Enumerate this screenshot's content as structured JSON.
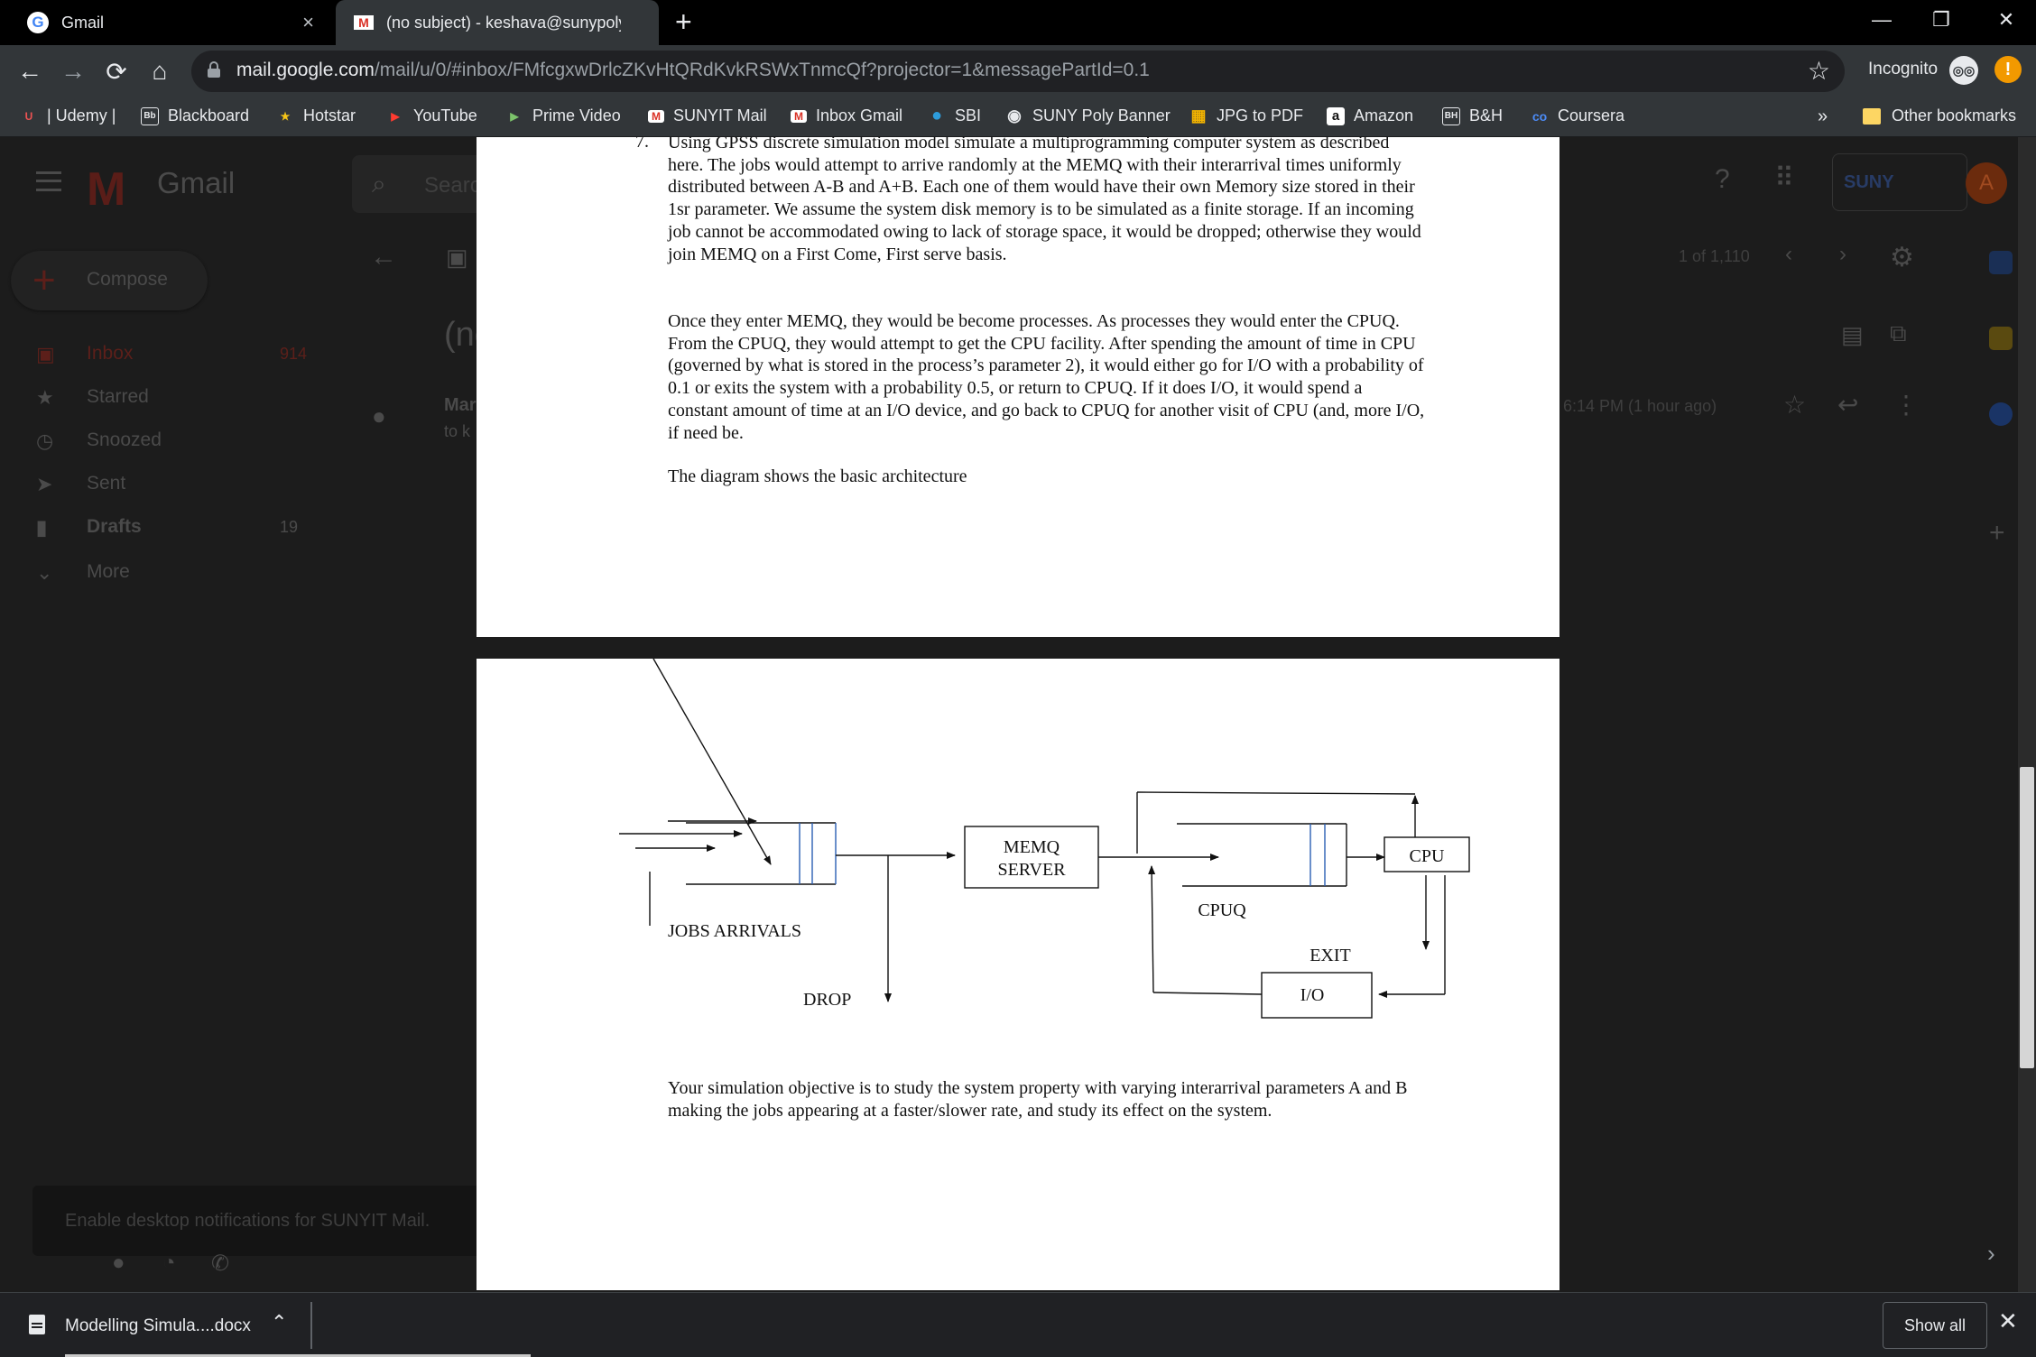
{
  "browser": {
    "tabs": [
      {
        "title": "Gmail",
        "close": "×"
      },
      {
        "title": "(no subject) - keshava@sunypoly",
        "close": "×"
      }
    ],
    "new_tab": "+",
    "window_controls": {
      "minimize": "—",
      "restore": "❐",
      "close": "✕"
    },
    "nav": {
      "back": "←",
      "forward": "→",
      "reload": "⟳",
      "home": "⌂"
    },
    "url_host": "mail.google.com",
    "url_path": "/mail/u/0/#inbox/FMfcgxwDrlcZKvHtQRdKvkRSWxTnmcQf?projector=1&messagePartId=0.1",
    "bookmark_star": "☆",
    "incognito_label": "Incognito",
    "incognito_icon_glyph": "◎◎",
    "alert_glyph": "!",
    "bookmarks": [
      {
        "label": "| Udemy |",
        "icon": "U",
        "color": "#ec5252"
      },
      {
        "label": "Blackboard",
        "icon": "Bb",
        "color": "#ffffff"
      },
      {
        "label": "Hotstar",
        "icon": "★",
        "color": "#f5c518"
      },
      {
        "label": "YouTube",
        "icon": "▶",
        "color": "#ff0000"
      },
      {
        "label": "Prime Video",
        "icon": "▶",
        "color": "#00a8e1"
      },
      {
        "label": "SUNYIT Mail",
        "icon": "M",
        "color": "#ffffff"
      },
      {
        "label": "Inbox Gmail",
        "icon": "M",
        "color": "#ffffff"
      },
      {
        "label": "SBI",
        "icon": "●",
        "color": "#2d9cdb"
      },
      {
        "label": "SUNY Poly Banner",
        "icon": "◉",
        "color": "#ffffff"
      },
      {
        "label": "JPG to PDF",
        "icon": "▦",
        "color": "#f4b400"
      },
      {
        "label": "Amazon",
        "icon": "a",
        "color": "#ffffff"
      },
      {
        "label": "B&H",
        "icon": "BH",
        "color": "#ffffff"
      },
      {
        "label": "Coursera",
        "icon": "co",
        "color": "#2a73cc"
      }
    ],
    "bookmarks_overflow": "»",
    "other_bookmarks": "Other bookmarks"
  },
  "gmail": {
    "logo_letter": "M",
    "logo_text": "Gmail",
    "search_placeholder": "Searc",
    "compose_label": "Compose",
    "nav": [
      {
        "label": "Inbox",
        "icon": "▣",
        "count": "914"
      },
      {
        "label": "Starred",
        "icon": "★",
        "count": ""
      },
      {
        "label": "Snoozed",
        "icon": "◷",
        "count": ""
      },
      {
        "label": "Sent",
        "icon": "➤",
        "count": ""
      },
      {
        "label": "Drafts",
        "icon": "▮",
        "count": "19"
      },
      {
        "label": "More",
        "icon": "⌄",
        "count": ""
      }
    ],
    "subject_partial": "(nc",
    "sender_partial": "Mar",
    "to_partial": "to k",
    "pagination": "1 of 1,110",
    "time": "6:14 PM (1 hour ago)",
    "suny_badge": "SUNY",
    "avatar_letter": "A",
    "notification": "Enable desktop notifications for SUNYIT Mail."
  },
  "document": {
    "item_number": "7.",
    "para1": "Using GPSS discrete simulation model simulate a multiprogramming computer system as described here. The jobs would attempt to arrive randomly at the MEMQ with their interarrival times uniformly distributed between A-B and A+B. Each one of them would have their own Memory size stored in their 1sr parameter. We assume the system disk memory  is to be simulated as a finite storage. If an incoming job cannot be accommodated owing to lack of storage space, it would be dropped; otherwise they would join MEMQ on a First Come, First serve basis.",
    "para2": "Once they enter MEMQ, they would be become processes. As processes they would enter the CPUQ. From the CPUQ, they would attempt to get the CPU facility. After spending the amount of time in CPU (governed by what is stored in the process’s parameter 2), it would either go for I/O with a probability of 0.1 or exits the system with a probability 0.5, or return to CPUQ. If it does I/O, it would spend a constant amount of time at an I/O device, and go back to CPUQ for another visit of CPU (and, more I/O, if need be.",
    "para3": "The diagram shows the basic architecture",
    "para4": "Your simulation objective is to study the system property with varying interarrival parameters A and B making the jobs appearing at a faster/slower rate, and study its effect on the system.",
    "diagram": {
      "memq_line1": "MEMQ",
      "memq_line2": "SERVER",
      "cpu": "CPU",
      "cpuq": "CPUQ",
      "exit": "EXIT",
      "io": "I/O",
      "jobs_arrivals": "JOBS ARRIVALS",
      "drop": "DROP"
    }
  },
  "downloads": {
    "file_name": "Modelling Simula....docx",
    "chevron": "⌃",
    "show_all": "Show all",
    "close": "✕"
  }
}
